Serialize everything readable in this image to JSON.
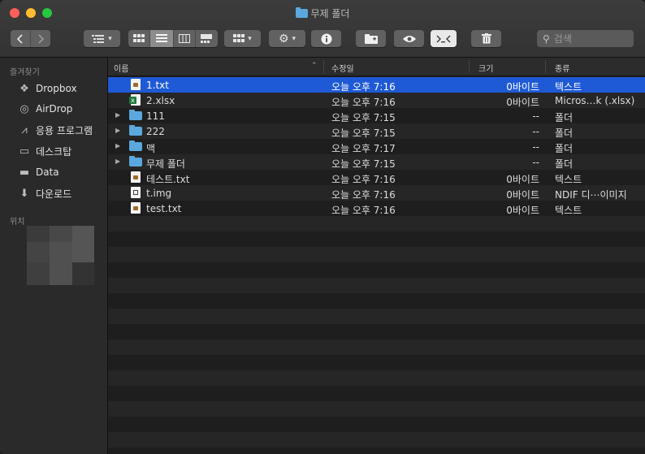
{
  "window": {
    "title": "무제 폴더"
  },
  "toolbar": {
    "back_icon": "chevron-left-icon",
    "forward_icon": "chevron-right-icon",
    "search_placeholder": "검색"
  },
  "sidebar": {
    "favorites_heading": "즐겨찾기",
    "locations_heading": "위치",
    "items": [
      {
        "label": "Dropbox",
        "icon": "dropbox-icon"
      },
      {
        "label": "AirDrop",
        "icon": "airdrop-icon"
      },
      {
        "label": "응용 프로그램",
        "icon": "applications-icon"
      },
      {
        "label": "데스크탑",
        "icon": "desktop-icon"
      },
      {
        "label": "Data",
        "icon": "folder-icon"
      },
      {
        "label": "다운로드",
        "icon": "downloads-icon"
      }
    ]
  },
  "columns": {
    "name": "이름",
    "date": "수정일",
    "size": "크기",
    "kind": "종류"
  },
  "files": [
    {
      "name": "1.txt",
      "date": "오늘 오후 7:16",
      "size": "0바이트",
      "kind": "텍스트",
      "type": "doc",
      "selected": true
    },
    {
      "name": "2.xlsx",
      "date": "오늘 오후 7:16",
      "size": "0바이트",
      "kind": "Micros…k (.xlsx)",
      "type": "xls"
    },
    {
      "name": "111",
      "date": "오늘 오후 7:15",
      "size": "--",
      "kind": "폴더",
      "type": "folder"
    },
    {
      "name": "222",
      "date": "오늘 오후 7:15",
      "size": "--",
      "kind": "폴더",
      "type": "folder"
    },
    {
      "name": "맥",
      "date": "오늘 오후 7:17",
      "size": "--",
      "kind": "폴더",
      "type": "folder"
    },
    {
      "name": "무제 폴더",
      "date": "오늘 오후 7:15",
      "size": "--",
      "kind": "폴더",
      "type": "folder"
    },
    {
      "name": "테스트.txt",
      "date": "오늘 오후 7:16",
      "size": "0바이트",
      "kind": "텍스트",
      "type": "doc"
    },
    {
      "name": "t.img",
      "date": "오늘 오후 7:16",
      "size": "0바이트",
      "kind": "NDIF 디⋯이미지",
      "type": "img"
    },
    {
      "name": "test.txt",
      "date": "오늘 오후 7:16",
      "size": "0바이트",
      "kind": "텍스트",
      "type": "doc"
    }
  ],
  "colors": {
    "selection": "#1f5ad6",
    "folder": "#5aa8dd",
    "close": "#fe5f57",
    "minimize": "#febc2e",
    "zoom": "#28c840"
  }
}
